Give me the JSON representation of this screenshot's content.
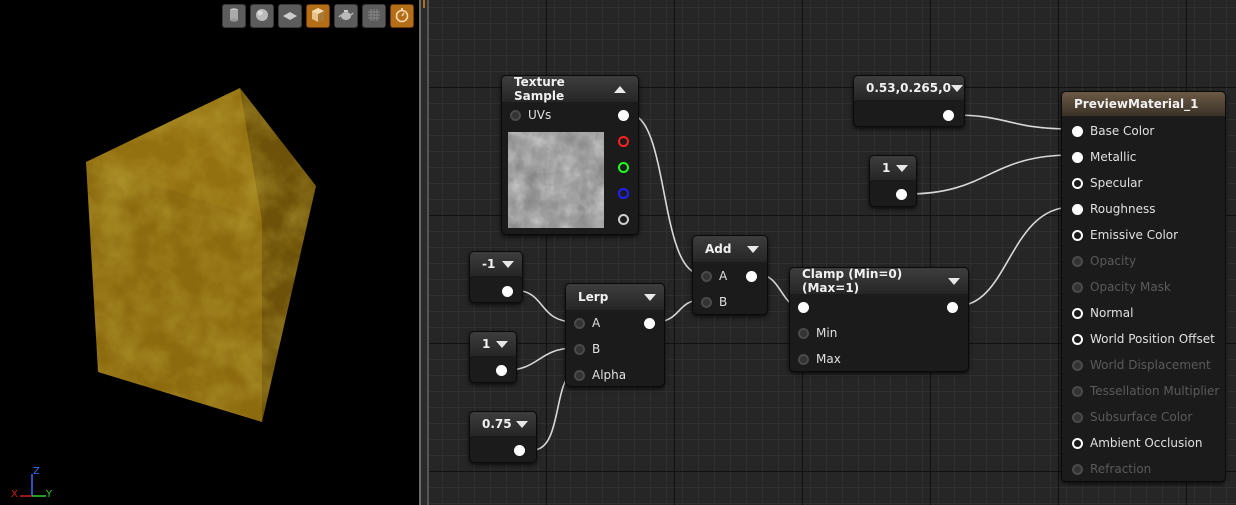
{
  "viewport": {
    "toolbar": [
      {
        "name": "cylinder-preview",
        "icon": "cylinder-icon",
        "active": false
      },
      {
        "name": "sphere-preview",
        "icon": "sphere-icon",
        "active": false
      },
      {
        "name": "plane-preview",
        "icon": "plane-icon",
        "active": false
      },
      {
        "name": "cube-preview",
        "icon": "cube-icon",
        "active": true
      },
      {
        "name": "mesh-preview",
        "icon": "teapot-icon",
        "active": false
      },
      {
        "name": "grid-toggle",
        "icon": "grid-icon",
        "active": false
      },
      {
        "name": "realtime-toggle",
        "icon": "stopwatch-icon",
        "active": true
      }
    ],
    "axis": {
      "x": "X",
      "y": "Y",
      "z": "Z"
    }
  },
  "nodes": {
    "texture_sample": {
      "title": "Texture Sample",
      "uvs_label": "UVs"
    },
    "const_neg1": {
      "value": "-1"
    },
    "const_1a": {
      "value": "1"
    },
    "const_075": {
      "value": "0.75"
    },
    "lerp": {
      "title": "Lerp",
      "a": "A",
      "b": "B",
      "alpha": "Alpha"
    },
    "add": {
      "title": "Add",
      "a": "A",
      "b": "B"
    },
    "clamp": {
      "title": "Clamp (Min=0) (Max=1)",
      "min": "Min",
      "max": "Max"
    },
    "const_vec3": {
      "value": "0.53,0.265,0"
    },
    "const_1b": {
      "value": "1"
    },
    "material": {
      "title": "PreviewMaterial_1",
      "inputs": [
        {
          "label": "Base Color",
          "enabled": true,
          "connected": true
        },
        {
          "label": "Metallic",
          "enabled": true,
          "connected": true
        },
        {
          "label": "Specular",
          "enabled": true,
          "connected": false
        },
        {
          "label": "Roughness",
          "enabled": true,
          "connected": true
        },
        {
          "label": "Emissive Color",
          "enabled": true,
          "connected": false
        },
        {
          "label": "Opacity",
          "enabled": false,
          "connected": false
        },
        {
          "label": "Opacity Mask",
          "enabled": false,
          "connected": false
        },
        {
          "label": "Normal",
          "enabled": true,
          "connected": false
        },
        {
          "label": "World Position Offset",
          "enabled": true,
          "connected": false
        },
        {
          "label": "World Displacement",
          "enabled": false,
          "connected": false
        },
        {
          "label": "Tessellation Multiplier",
          "enabled": false,
          "connected": false
        },
        {
          "label": "Subsurface Color",
          "enabled": false,
          "connected": false
        },
        {
          "label": "Ambient Occlusion",
          "enabled": true,
          "connected": false
        },
        {
          "label": "Refraction",
          "enabled": false,
          "connected": false
        }
      ]
    }
  },
  "colors": {
    "accent": "#b36e17",
    "cube_base": "#8a6a10"
  }
}
